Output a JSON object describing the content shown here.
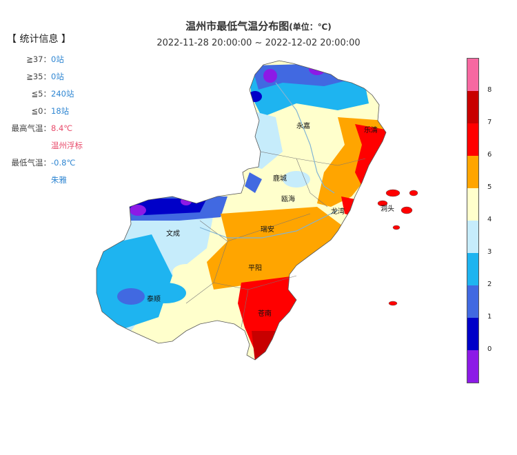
{
  "title": "温州市最低气温分布图",
  "title_unit": "(单位：℃)",
  "time_range": "2022-11-28 20:00:00 ~ 2022-12-02 20:00:00",
  "stats": {
    "heading": "【 统计信息 】",
    "rows": [
      {
        "label": "≧37：",
        "value": "0站"
      },
      {
        "label": "≧35：",
        "value": "0站"
      },
      {
        "label": "≦5：",
        "value": "240站"
      },
      {
        "label": "≦0：",
        "value": "18站"
      },
      {
        "label": "最高气温：",
        "value": "8.4℃"
      },
      {
        "label": "",
        "value": "温州浮标"
      },
      {
        "label": "最低气温：",
        "value": "-0.8℃"
      },
      {
        "label": "",
        "value": "朱雅"
      }
    ]
  },
  "cities": [
    "永嘉",
    "乐清",
    "鹿城",
    "瓯海",
    "龙湾",
    "洞头",
    "文成",
    "瑞安",
    "平阳",
    "泰顺",
    "苍南"
  ],
  "legend": {
    "labels": [
      "8",
      "7",
      "6",
      "5",
      "4",
      "3",
      "2",
      "1",
      "0"
    ],
    "colors": [
      "#f768a1",
      "#c80000",
      "#ff0000",
      "#ffa500",
      "#ffffcc",
      "#c6ecfb",
      "#1eb4f0",
      "#4169e1",
      "#0000c8",
      "#8c1ae6"
    ]
  }
}
